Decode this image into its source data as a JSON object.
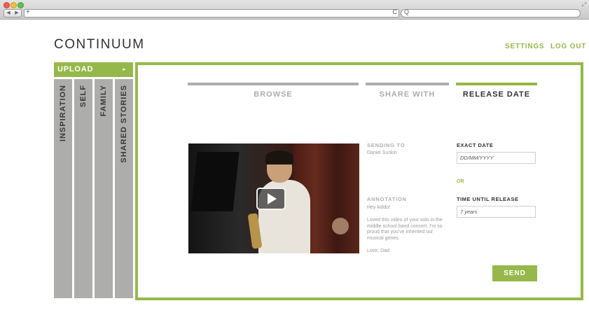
{
  "browser": {
    "nav_back": "◀",
    "nav_forward": "▶",
    "new_tab": "+",
    "reload": "C",
    "search_glyph": "Q"
  },
  "header": {
    "logo": "CONTINUUM",
    "settings": "SETTINGS",
    "logout": "LOG OUT"
  },
  "sidebar": {
    "upload": "UPLOAD",
    "upload_arrow": "▸",
    "tabs": [
      "INSPIRATION",
      "SELF",
      "FAMILY",
      "SHARED STORIES"
    ]
  },
  "steps": [
    {
      "label": "BROWSE",
      "state": "done"
    },
    {
      "label": "SHARE WITH",
      "state": "done"
    },
    {
      "label": "RELEASE DATE",
      "state": "active"
    }
  ],
  "sending_to": {
    "label": "SENDING TO",
    "value": "Daniel Suskin"
  },
  "annotation": {
    "label": "ANNOTATION",
    "greeting": "Hey kiddo!",
    "body": "Loved this video of your solo in the middle school band concert. I'm so proud that you've inherited our musical genes.",
    "signoff": "Love, Dad"
  },
  "exact_date": {
    "label": "EXACT DATE",
    "placeholder": "DD/MM/YYYY"
  },
  "or_text": "OR",
  "time_until": {
    "label": "TIME UNTIL RELEASE",
    "value": "7 years"
  },
  "send_button": "SEND",
  "colors": {
    "accent": "#96b84a",
    "tab_gray": "#adadab",
    "text_dark": "#333333"
  }
}
